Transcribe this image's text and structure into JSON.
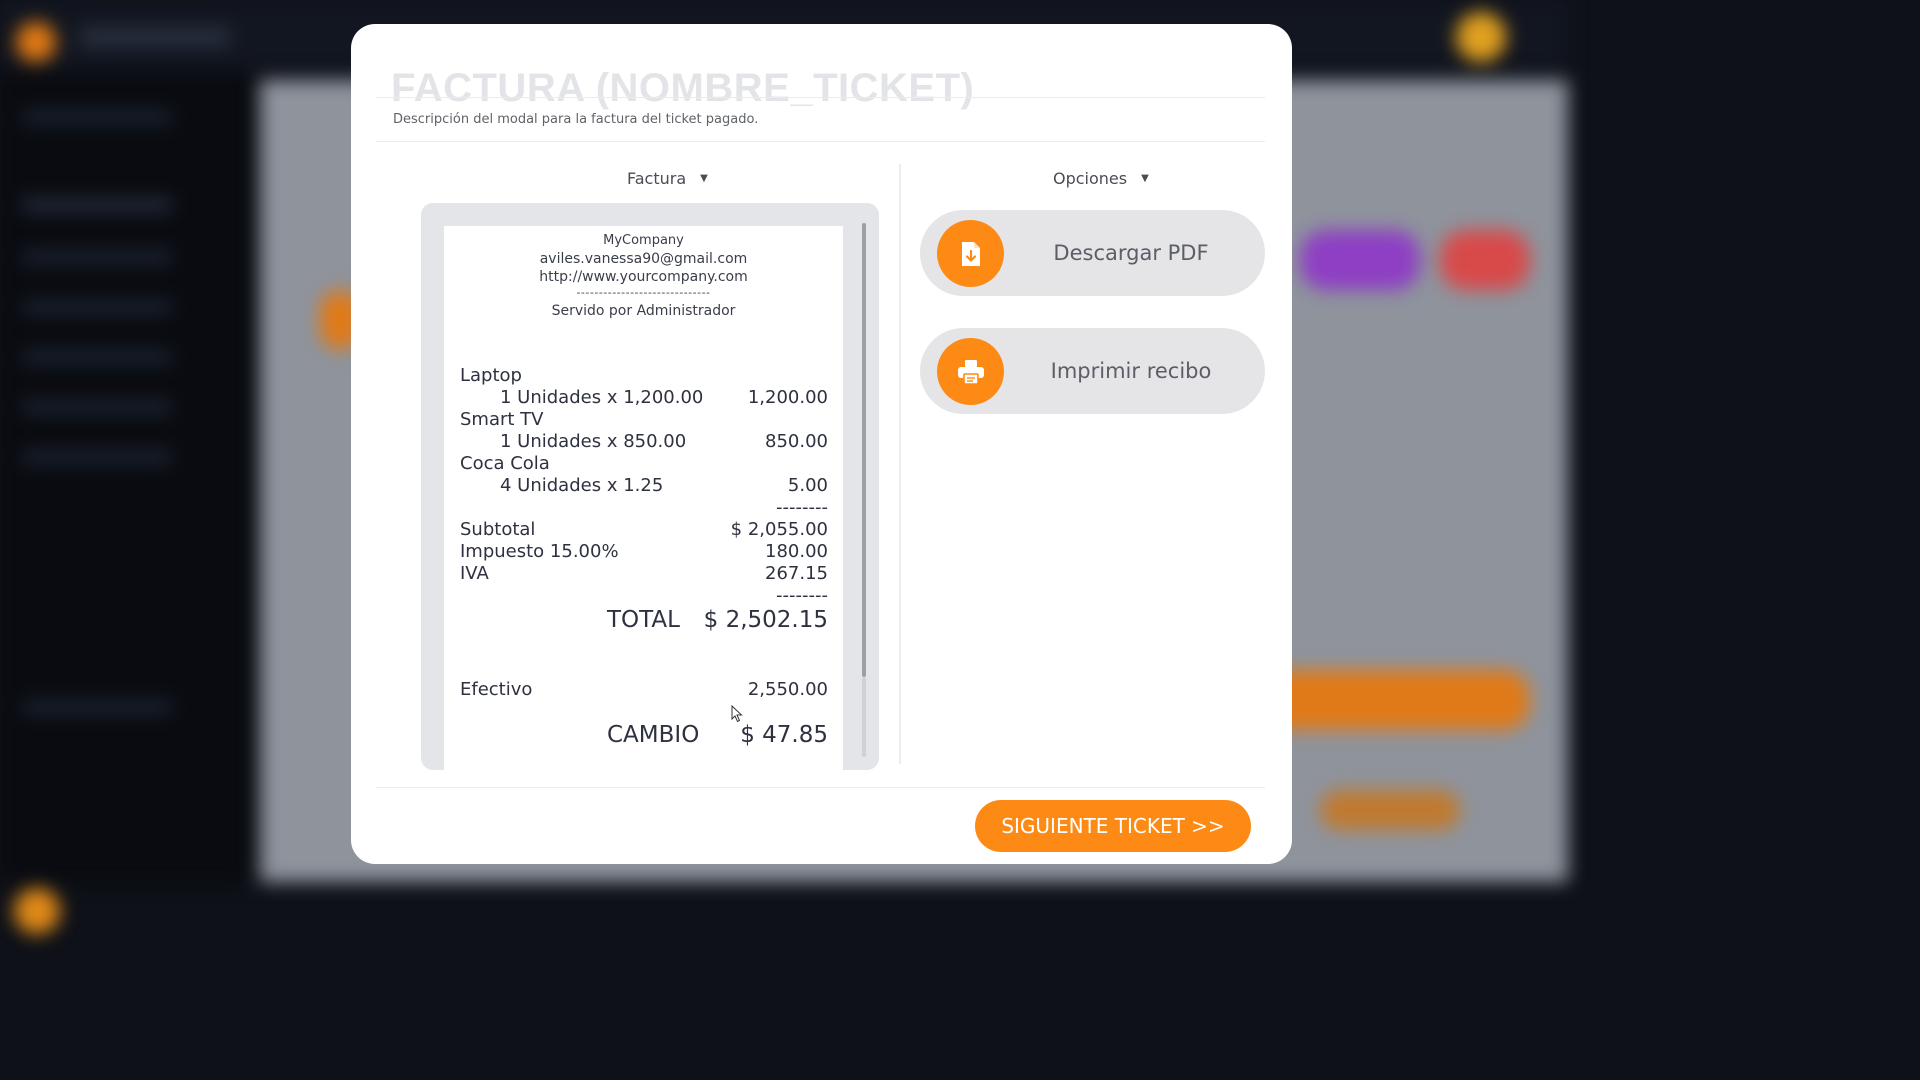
{
  "modal": {
    "title": "FACTURA (NOMBRE_TICKET)",
    "description": "Descripción del modal para la factura del ticket pagado.",
    "next_button_label": "SIGUIENTE TICKET >>"
  },
  "invoice_panel": {
    "header": "Factura",
    "receipt": {
      "company": "MyCompany",
      "email": "aviles.vanessa90@gmail.com",
      "website": "http://www.yourcompany.com",
      "separator": "------------------------------",
      "served_by": "Servido por Administrador",
      "items": [
        {
          "name": "Laptop",
          "detail": "1 Unidades x 1,200.00",
          "amount": "1,200.00"
        },
        {
          "name": "Smart TV",
          "detail": "1 Unidades x 850.00",
          "amount": "850.00"
        },
        {
          "name": "Coca Cola",
          "detail": "4 Unidades x 1.25",
          "amount": "5.00"
        }
      ],
      "dashes": "--------",
      "subtotal_label": "Subtotal",
      "subtotal_value": "$ 2,055.00",
      "tax_label": "Impuesto 15.00%",
      "tax_value": "180.00",
      "iva_label": "IVA",
      "iva_value": "267.15",
      "total_label": "TOTAL",
      "total_value": "$ 2,502.15",
      "cash_label": "Efectivo",
      "cash_value": "2,550.00",
      "change_label": "CAMBIO",
      "change_value": "$ 47.85"
    }
  },
  "options_panel": {
    "header": "Opciones",
    "buttons": [
      {
        "label": "Descargar PDF",
        "icon": "file-download-icon"
      },
      {
        "label": "Imprimir recibo",
        "icon": "printer-icon"
      }
    ]
  },
  "colors": {
    "accent": "#fd8a14",
    "option_button_bg": "#e5e5e8",
    "title_faded": "#e3e4e8"
  }
}
